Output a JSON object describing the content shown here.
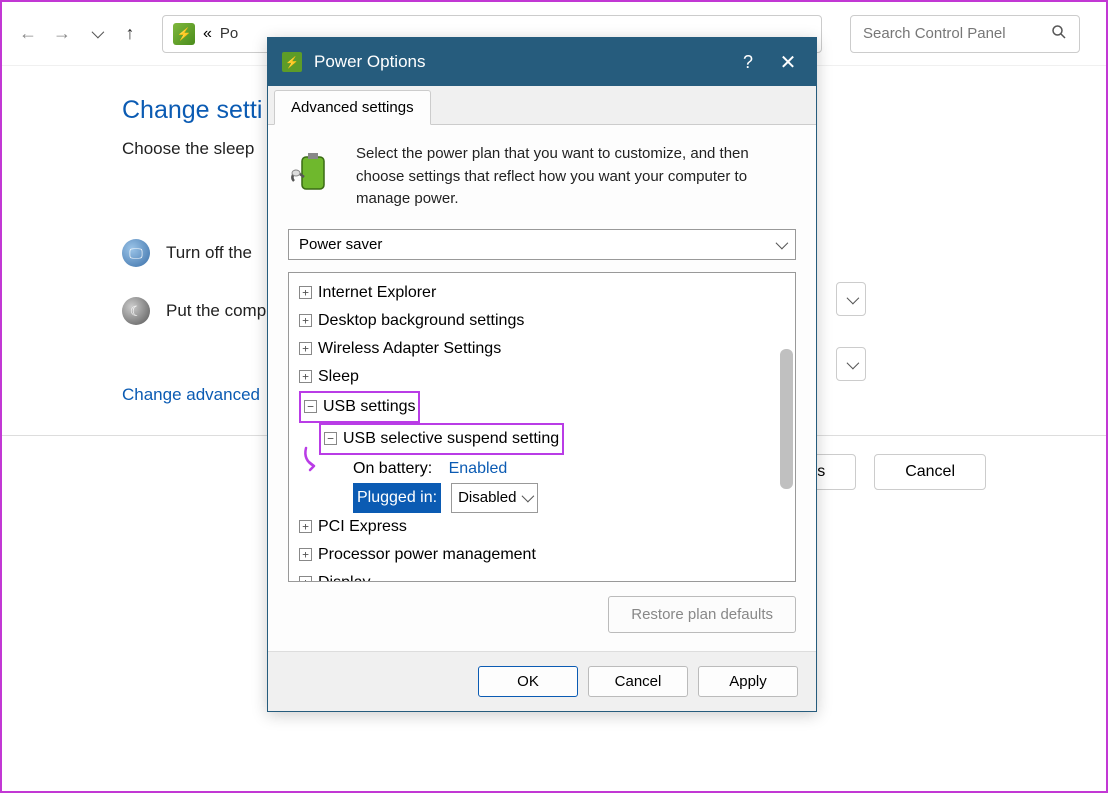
{
  "toolbar": {
    "breadcrumb_prefix": "«",
    "breadcrumb_text": "Po",
    "search_placeholder": "Search Control Panel"
  },
  "background": {
    "heading": "Change setti",
    "subheading": "Choose the sleep",
    "row1": "Turn off the ",
    "row2": "Put the comp",
    "link": "Change advanced",
    "save_btn": "s",
    "cancel_btn": "Cancel"
  },
  "dialog": {
    "title": "Power Options",
    "help": "?",
    "close": "✕",
    "tab": "Advanced settings",
    "intro": "Select the power plan that you want to customize, and then choose settings that reflect how you want your computer to manage power.",
    "plan": "Power saver",
    "tree": {
      "items": [
        "Internet Explorer",
        "Desktop background settings",
        "Wireless Adapter Settings",
        "Sleep",
        "USB settings",
        "USB selective suspend setting",
        "PCI Express",
        "Processor power management",
        "Display"
      ],
      "on_battery_label": "On battery:",
      "on_battery_value": "Enabled",
      "plugged_in_label": "Plugged in:",
      "plugged_in_value": "Disabled"
    },
    "restore": "Restore plan defaults",
    "ok": "OK",
    "cancel": "Cancel",
    "apply": "Apply"
  }
}
